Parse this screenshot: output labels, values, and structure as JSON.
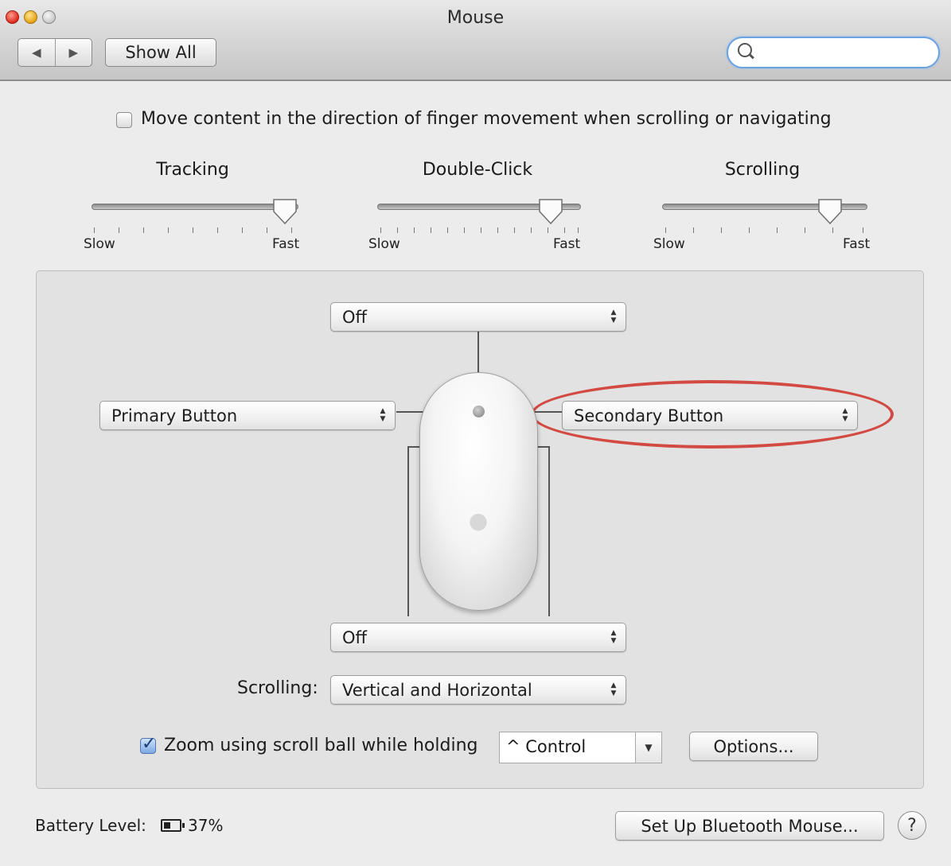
{
  "window": {
    "title": "Mouse"
  },
  "toolbar": {
    "back_icon": "◀",
    "forward_icon": "▶",
    "show_all_label": "Show All",
    "search_placeholder": ""
  },
  "scroll_direction": {
    "checked": false,
    "label": "Move content in the direction of finger movement when scrolling or navigating"
  },
  "sliders": [
    {
      "title": "Tracking",
      "min_label": "Slow",
      "max_label": "Fast",
      "value_fraction": 0.93
    },
    {
      "title": "Double-Click",
      "min_label": "Slow",
      "max_label": "Fast",
      "value_fraction": 0.84
    },
    {
      "title": "Scrolling",
      "min_label": "Slow",
      "max_label": "Fast",
      "value_fraction": 0.81
    }
  ],
  "buttons_panel": {
    "top_popup": "Off",
    "left_popup": "Primary Button",
    "right_popup": "Secondary Button",
    "bottom_popup": "Off",
    "scrolling_label": "Scrolling:",
    "scrolling_popup": "Vertical and Horizontal",
    "zoom_checked": true,
    "zoom_label": "Zoom using scroll ball while holding",
    "zoom_modifier": "^ Control",
    "options_label": "Options..."
  },
  "footer": {
    "battery_label": "Battery Level:",
    "battery_percent": "37%",
    "setup_label": "Set Up Bluetooth Mouse...",
    "help_label": "?"
  },
  "colors": {
    "highlight_ellipse": "#d24a42",
    "search_focus": "#6ba2e0"
  }
}
